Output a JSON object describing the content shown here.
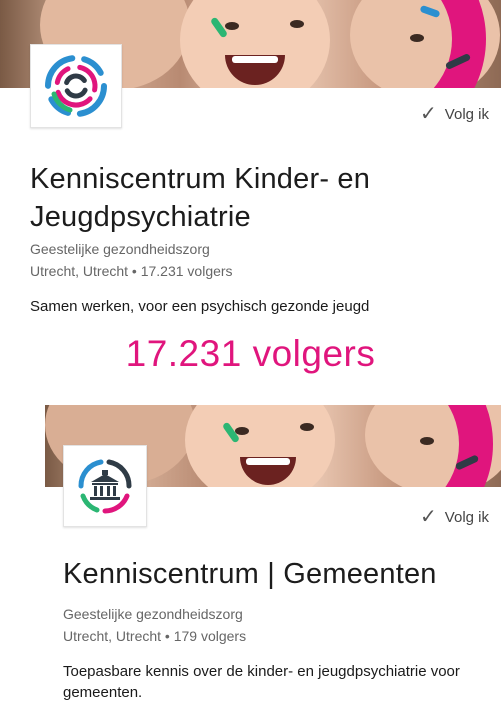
{
  "cards": [
    {
      "follow_label": "Volg ik",
      "title": "Kenniscentrum Kinder- en Jeugdpsychiatrie",
      "category": "Geestelijke gezondheidszorg",
      "location_followers": "Utrecht, Utrecht • 17.231 volgers",
      "tagline": "Samen werken, voor een psychisch gezonde jeugd"
    },
    {
      "follow_label": "Volg ik",
      "title": "Kenniscentrum | Gemeenten",
      "category": "Geestelijke gezondheidszorg",
      "location_followers": "Utrecht, Utrecht • 179 volgers",
      "tagline": "Toepasbare kennis over de kinder- en jeugdpsychiatrie voor gemeenten."
    }
  ],
  "highlight": "17.231 volgers",
  "colors": {
    "accent_pink": "#e0157d",
    "logo_blue": "#2b8fd0",
    "logo_green": "#2bb673",
    "logo_dark": "#2f3b46"
  },
  "icons": {
    "follow": "check-icon",
    "logo_1": "kenniscentrum-swirl-logo",
    "logo_2": "building-logo"
  }
}
